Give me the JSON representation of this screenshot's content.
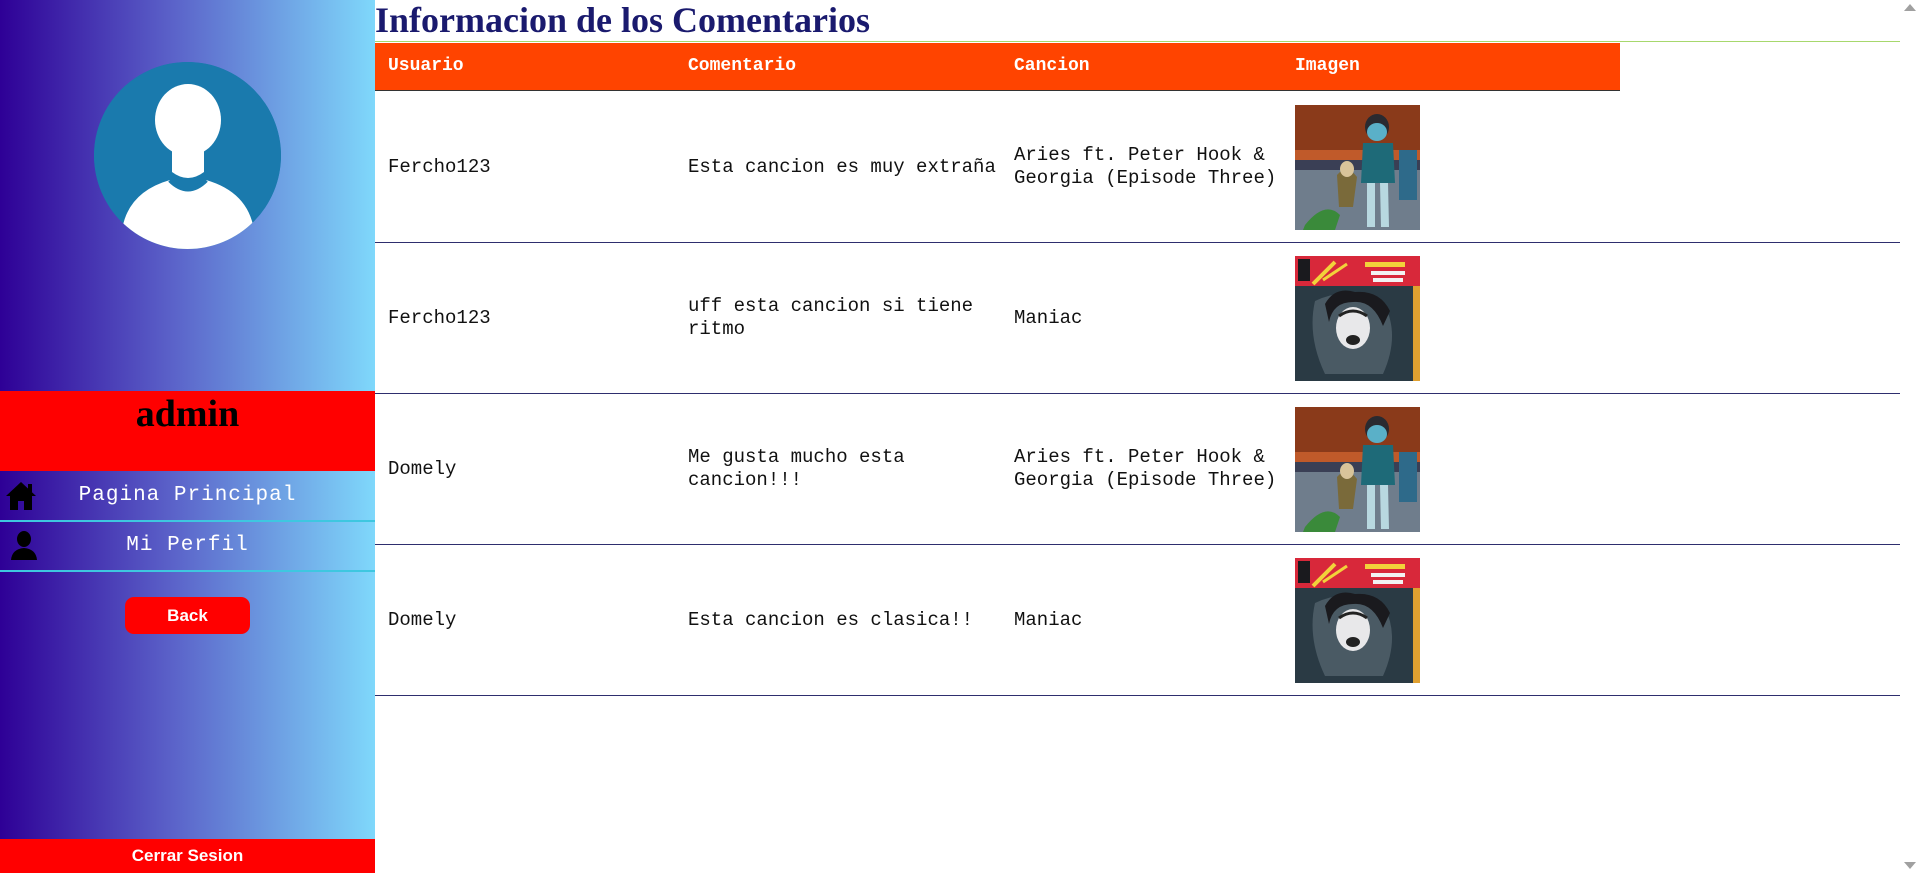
{
  "sidebar": {
    "username": "admin",
    "nav": [
      {
        "label": "Pagina Principal",
        "icon": "home-icon"
      },
      {
        "label": "Mi Perfil",
        "icon": "user-icon"
      }
    ],
    "back_label": "Back",
    "logout_label": "Cerrar Sesion"
  },
  "main": {
    "title": "Informacion de los Comentarios",
    "columns": [
      "Usuario",
      "Comentario",
      "Cancion",
      "Imagen"
    ],
    "rows": [
      {
        "usuario": "Fercho123",
        "comentario": "Esta cancion es muy extraña",
        "cancion": "Aries ft. Peter Hook & Georgia (Episode Three)",
        "imagen": "gorillaz-cover"
      },
      {
        "usuario": "Fercho123",
        "comentario": "uff esta cancion si tiene ritmo",
        "cancion": "Maniac",
        "imagen": "flashdance-maniac-cover"
      },
      {
        "usuario": "Domely",
        "comentario": "Me gusta mucho esta cancion!!!",
        "cancion": "Aries ft. Peter Hook & Georgia (Episode Three)",
        "imagen": "gorillaz-cover"
      },
      {
        "usuario": "Domely",
        "comentario": "Esta cancion es clasica!!",
        "cancion": "Maniac",
        "imagen": "flashdance-maniac-cover"
      }
    ]
  },
  "colors": {
    "header_bg": "#ff4400",
    "accent_red": "#ff0000",
    "title_color": "#1a1a6e",
    "sidebar_gradient_start": "#2e0096",
    "sidebar_gradient_end": "#7fd8fb"
  }
}
